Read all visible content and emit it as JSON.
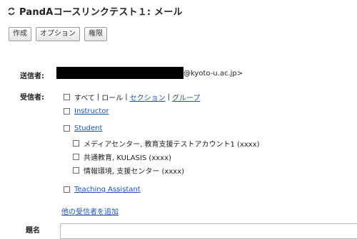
{
  "page": {
    "title": "PandAコースリンクテスト１: メール",
    "refresh_icon": "refresh-icon"
  },
  "toolbar": {
    "compose_label": "作成",
    "options_label": "オプション",
    "permissions_label": "権限"
  },
  "form": {
    "sender_label": "送信者:",
    "sender_suffix": "@kyoto-u.ac.jp>",
    "to_label": "受信者:",
    "subject_label": "題名"
  },
  "recipients": {
    "all_label": "すべて",
    "role_label": "ロール",
    "section_link": "セクション",
    "group_link": "グループ",
    "separator": "|",
    "instructor": "Instructor",
    "student": "Student",
    "student_sections": [
      "メディアセンター, 教育支援テストアカウント1 (xxxx)",
      "共通教育, KULASIS (xxxx)",
      "情報環境, 支援センター (xxxx)"
    ],
    "teaching_assistant": "Teaching Assistant",
    "add_other": "他の受信者を追加"
  },
  "colors": {
    "link": "#1a55b8",
    "redaction": "#000000"
  }
}
